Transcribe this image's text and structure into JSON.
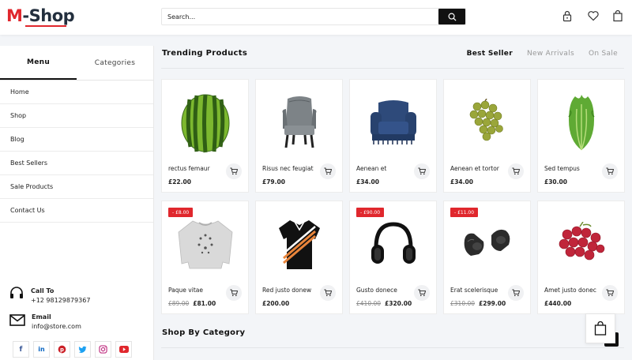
{
  "header": {
    "logo_m": "M",
    "logo_rest": "-Shop",
    "search_placeholder": "Search...",
    "icons": [
      "lock-icon",
      "heart-icon",
      "bag-icon"
    ]
  },
  "sidebar": {
    "tabs": [
      {
        "label": "Menu",
        "active": true
      },
      {
        "label": "Categories",
        "active": false
      }
    ],
    "items": [
      "Home",
      "Shop",
      "Blog",
      "Best Sellers",
      "Sale Products",
      "Contact Us"
    ],
    "call_title": "Call To",
    "call_value": "+12 98129879367",
    "email_title": "Email",
    "email_value": "info@store.com",
    "social": [
      "facebook-icon",
      "linkedin-icon",
      "pinterest-icon",
      "twitter-icon",
      "instagram-icon",
      "youtube-icon"
    ]
  },
  "trending": {
    "title": "Trending Products",
    "filters": [
      {
        "label": "Best Seller",
        "active": true
      },
      {
        "label": "New Arrivals",
        "active": false
      },
      {
        "label": "On Sale",
        "active": false
      }
    ]
  },
  "products": [
    {
      "name": "rectus femaur",
      "price": "£22.00",
      "old_price": "",
      "badge": "",
      "image": "watermelon"
    },
    {
      "name": "Risus nec feugiat",
      "price": "£79.00",
      "old_price": "",
      "badge": "",
      "image": "wingback-chair"
    },
    {
      "name": "Aenean et",
      "price": "£34.00",
      "old_price": "",
      "badge": "",
      "image": "armchair"
    },
    {
      "name": "Aenean et tortor",
      "price": "£34.00",
      "old_price": "",
      "badge": "",
      "image": "grapes"
    },
    {
      "name": "Sed tempus",
      "price": "£30.00",
      "old_price": "",
      "badge": "",
      "image": "lettuce"
    },
    {
      "name": "Paque vitae",
      "price": "£81.00",
      "old_price": "£89.00",
      "badge": "- £8.00",
      "image": "sweatshirt"
    },
    {
      "name": "Red justo donew",
      "price": "£200.00",
      "old_price": "",
      "badge": "",
      "image": "polo-shirt"
    },
    {
      "name": "Gusto donece",
      "price": "£320.00",
      "old_price": "£410.00",
      "badge": "- £90.00",
      "image": "headphones"
    },
    {
      "name": "Erat scelerisque",
      "price": "£299.00",
      "old_price": "£310.00",
      "badge": "- £11.00",
      "image": "earbuds"
    },
    {
      "name": "Amet justo donec",
      "price": "£440.00",
      "old_price": "",
      "badge": "",
      "image": "red-grapes"
    }
  ],
  "category_section": {
    "title": "Shop By Category"
  },
  "colors": {
    "accent": "#e0272d",
    "dark": "#232f3e",
    "black": "#111111"
  }
}
